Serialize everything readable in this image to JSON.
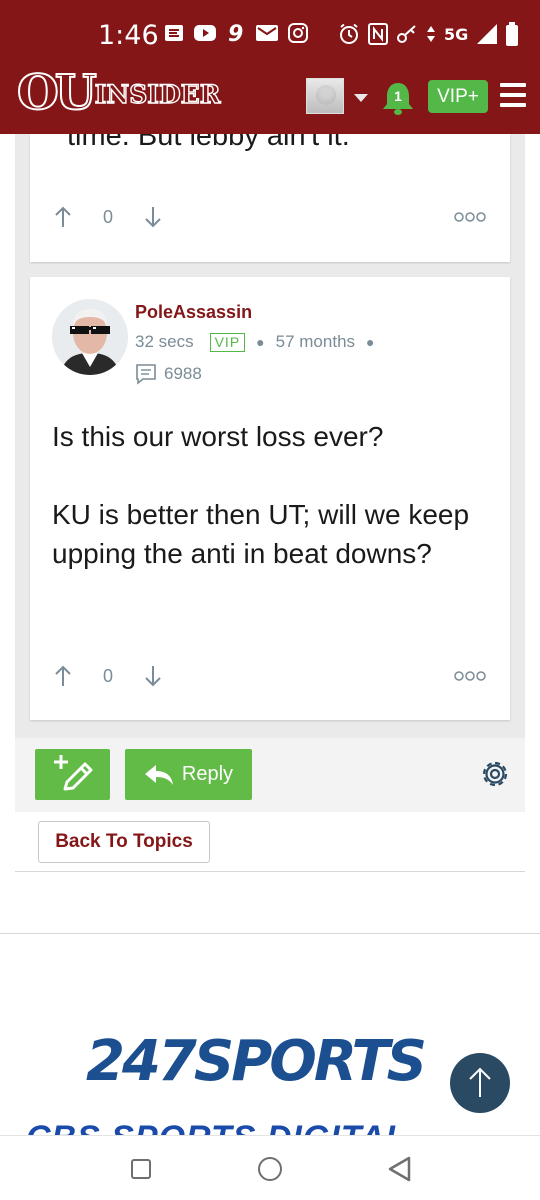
{
  "status_bar": {
    "time": "1:46",
    "network": "5G",
    "left_icons": [
      "e-icon",
      "youtube-icon",
      "nine-icon",
      "mail-icon",
      "instagram-icon"
    ],
    "right_icons": [
      "alarm-icon",
      "nfc-icon",
      "vpn-key-icon",
      "data-icon",
      "signal-icon",
      "battery-icon"
    ]
  },
  "header": {
    "logo_ou": "OU",
    "logo_insider": "INSIDER",
    "notification_count": "1",
    "vip_label": "VIP+",
    "brand_color": "#841617"
  },
  "posts": [
    {
      "text_partial": "time. But lebby ain't it.",
      "votes": "0"
    },
    {
      "username": "PoleAssassin",
      "time_ago": "32 secs",
      "badge": "VIP",
      "member_for": "57 months",
      "post_count": "6988",
      "body": [
        "Is this our worst loss ever?",
        "KU is better then UT; will we keep upping the anti in beat downs?"
      ],
      "votes": "0"
    }
  ],
  "actions": {
    "reply_label": "Reply",
    "back_label": "Back To Topics",
    "accent": "#62bb46"
  },
  "footer": {
    "brand": "247SPORTS",
    "network_partial": "CBS SPORTS DIGITAL"
  }
}
